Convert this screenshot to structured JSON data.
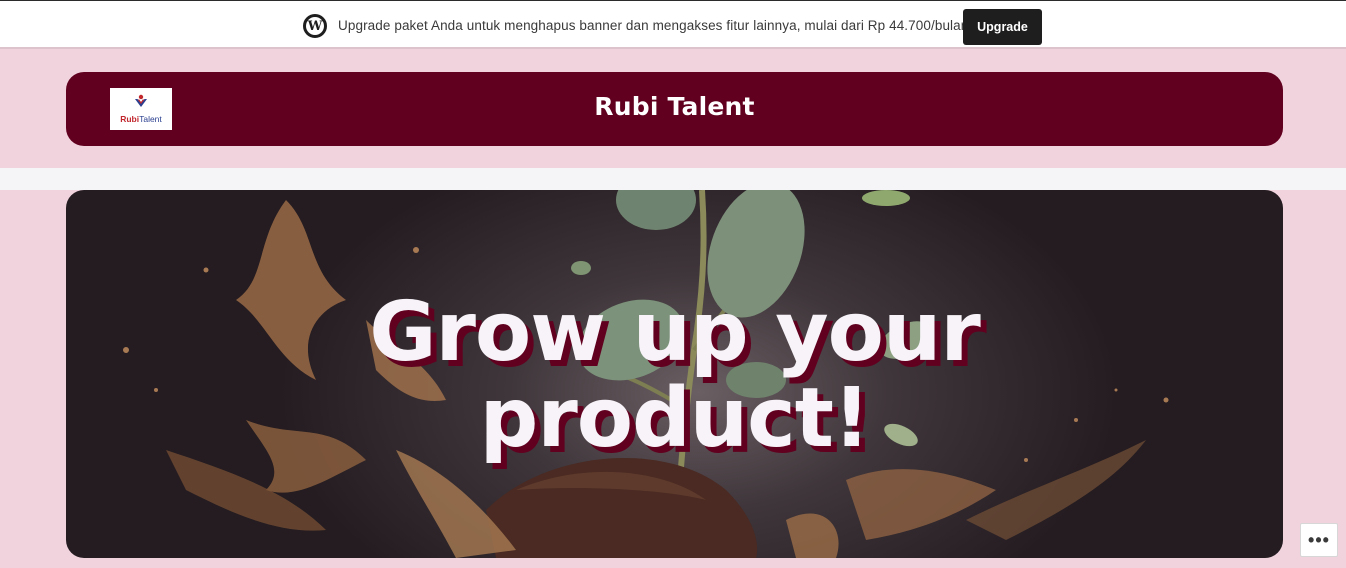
{
  "banner": {
    "text": "Upgrade paket Anda untuk menghapus banner dan mengakses fitur lainnya, mulai dari Rp 44.700/bulan",
    "button_label": "Upgrade",
    "logo_glyph": "W"
  },
  "header": {
    "site_title": "Rubi Talent",
    "logo": {
      "brand_part1": "Rubi",
      "brand_part2": "Talent"
    }
  },
  "hero": {
    "title_line1": "Grow up your",
    "title_line2": "product!"
  },
  "more_options": {
    "label": "•••"
  },
  "colors": {
    "page_bg": "#f1d3de",
    "header_bg": "#61001f",
    "hero_text": "#f7f3f8",
    "hero_shadow": "#61001f",
    "button_bg": "#1e1e1e"
  }
}
